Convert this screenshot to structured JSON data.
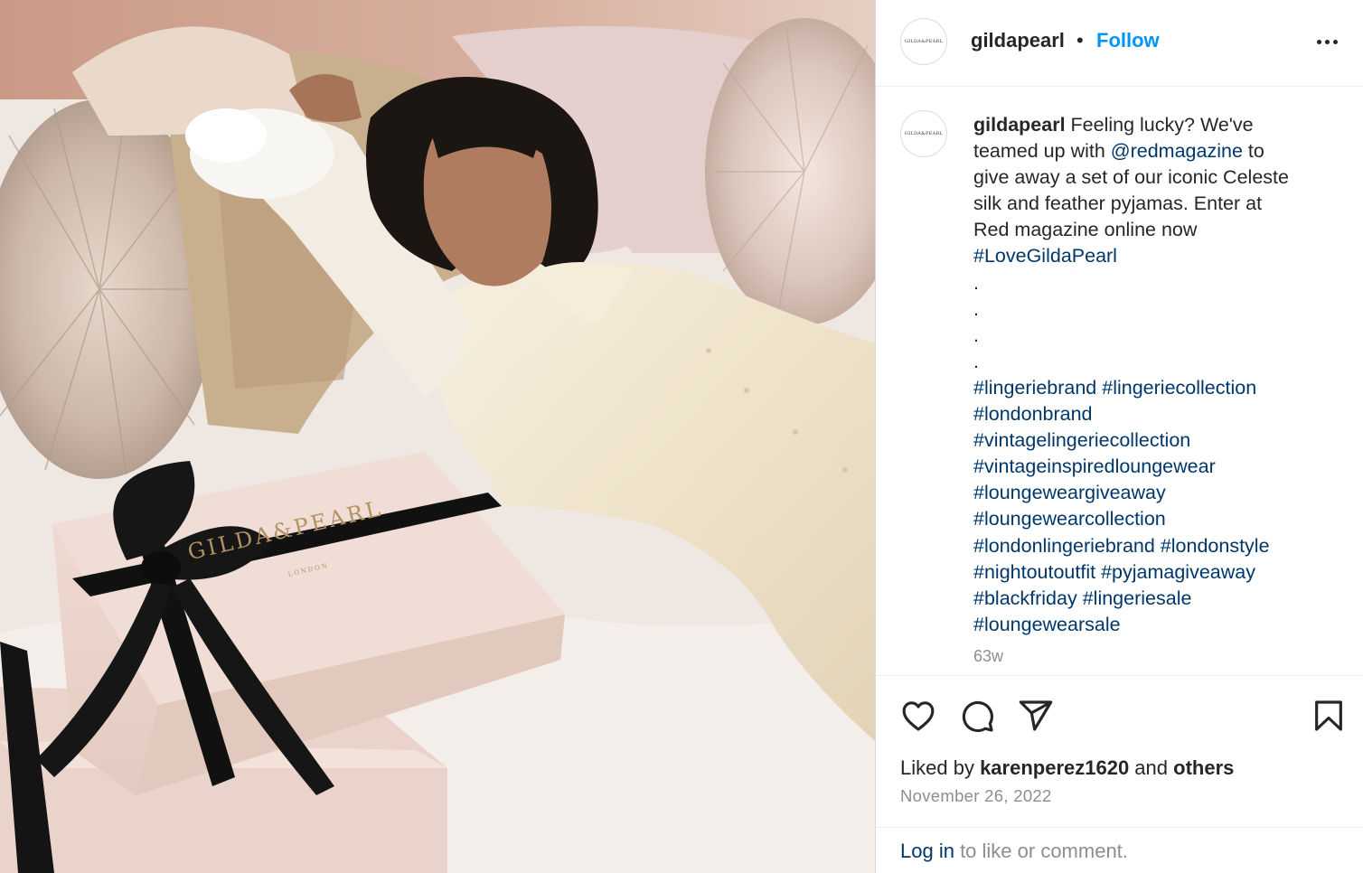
{
  "post": {
    "image_alt": "Model in cream silk pyjamas with feather cuffs lying on a bed beside Gilda & Pearl gift boxes",
    "image_brand": "GILDA&PEARL",
    "image_brand_sub": "LONDON"
  },
  "header": {
    "avatar_text": "GILDA&PEARL",
    "username": "gildapearl",
    "separator": "•",
    "follow_label": "Follow",
    "more_icon": "more-options-icon"
  },
  "caption": {
    "avatar_text": "GILDA&PEARL",
    "username": "gildapearl",
    "text_1": " Feeling lucky? We've",
    "text_2": "teamed up with ",
    "mention": "@redmagazine",
    "text_3": " to",
    "text_4": "give away a set of our iconic Celeste",
    "text_5": "silk and feather pyjamas. Enter at",
    "text_6": "Red magazine online now",
    "dots": [
      ".",
      ".",
      ".",
      "."
    ],
    "hashtag_lines": [
      [
        "#LoveGildaPearl"
      ],
      [],
      [
        "#lingeriebrand",
        "#lingeriecollection"
      ],
      [
        "#londonbrand"
      ],
      [
        "#vintagelingeriecollection"
      ],
      [
        "#vintageinspiredloungewear"
      ],
      [
        "#loungeweargiveaway"
      ],
      [
        "#loungewearcollection"
      ],
      [
        "#londonlingeriebrand",
        "#londonstyle"
      ],
      [
        "#nightoutoutfit",
        "#pyjamagiveaway"
      ],
      [
        "#blackfriday",
        "#lingeriesale"
      ],
      [
        "#loungewearsale"
      ]
    ],
    "time_ago": "63w"
  },
  "actions": {
    "like_icon": "heart-icon",
    "comment_icon": "comment-icon",
    "share_icon": "share-icon",
    "save_icon": "bookmark-icon"
  },
  "likes": {
    "prefix": "Liked by ",
    "user": "karenperez1620",
    "middle": " and ",
    "others": "others"
  },
  "date": "November 26, 2022",
  "login": {
    "link": "Log in",
    "rest": " to like or comment."
  },
  "colors": {
    "accent_blue": "#0095f6",
    "link_blue": "#00376b",
    "muted": "#8e8e8e",
    "text": "#262626"
  }
}
